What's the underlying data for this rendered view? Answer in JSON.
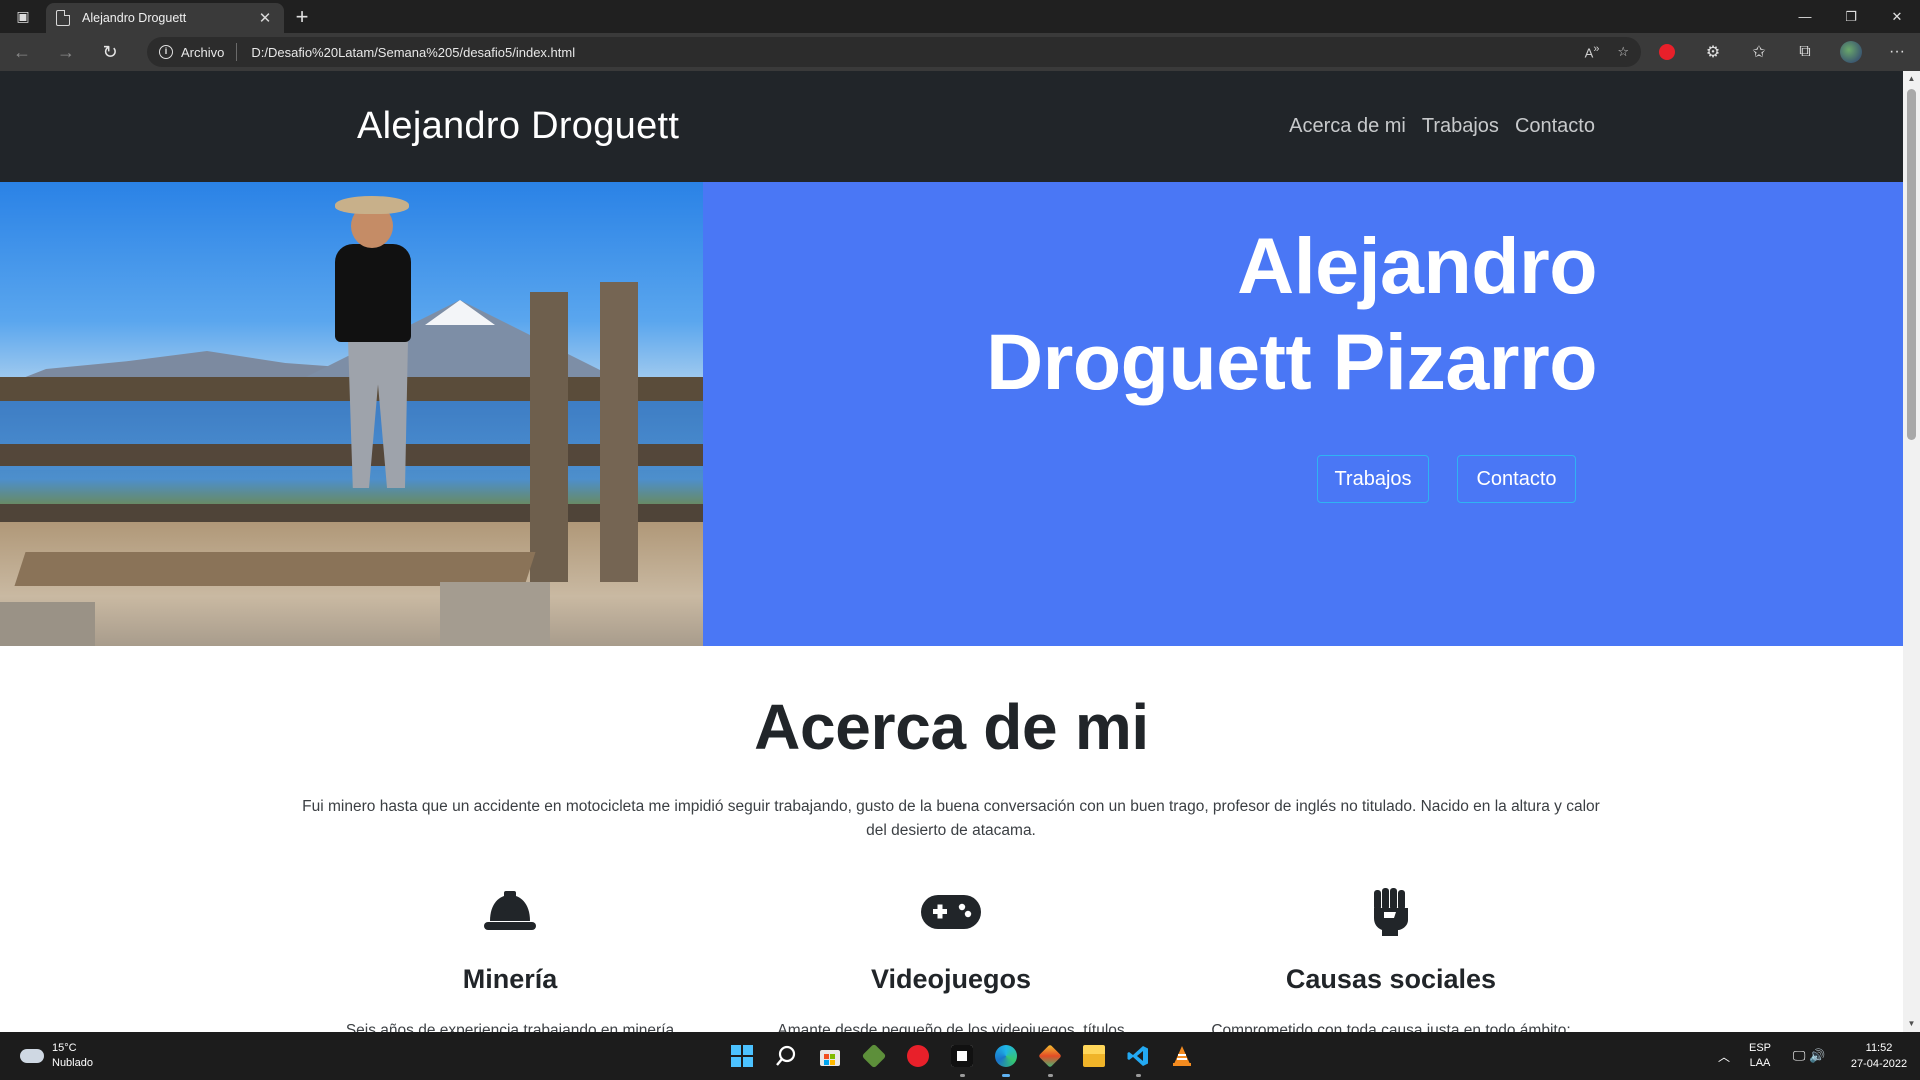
{
  "browser": {
    "tab_title": "Alejandro Droguett",
    "address_label": "Archivo",
    "url": "D:/Desafio%20Latam/Semana%205/desafio5/index.html"
  },
  "site": {
    "brand": "Alejandro Droguett",
    "nav": [
      "Acerca de mi",
      "Trabajos",
      "Contacto"
    ],
    "hero": {
      "title_line1": "Alejandro",
      "title_line2": "Droguett Pizarro",
      "button_trabajos": "Trabajos",
      "button_contacto": "Contacto"
    },
    "about": {
      "title": "Acerca de mi",
      "text": "Fui minero hasta que un accidente en motocicleta me impidió seguir trabajando, gusto de la buena conversación con un buen trago, profesor de inglés no titulado. Nacido en la altura y calor del desierto de atacama.",
      "features": [
        {
          "icon": "hard-hat-icon",
          "title": "Minería",
          "text": "Seis años de experiencia trabajando en minería"
        },
        {
          "icon": "gamepad-icon",
          "title": "Videojuegos",
          "text": "Amante desde pequeño de los videojuegos, títulos"
        },
        {
          "icon": "fist-icon",
          "title": "Causas sociales",
          "text": "Comprometido con toda causa justa en todo ámbito;"
        }
      ]
    }
  },
  "taskbar": {
    "weather_temp": "15°C",
    "weather_desc": "Nublado",
    "lang_line1": "ESP",
    "lang_line2": "LAA",
    "time": "11:52",
    "date": "27-04-2022"
  },
  "colors": {
    "hero_panel": "#4a77f5",
    "navbar": "#212529",
    "button_border": "#2fb3f3"
  }
}
